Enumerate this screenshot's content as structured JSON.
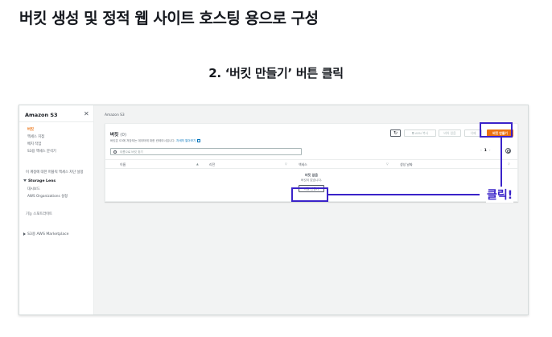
{
  "doc": {
    "title": "버킷 생성 및 정적 웹 사이트 호스팅 용으로 구성",
    "step": "2. ‘버킷 만들기’ 버튼 클릭",
    "annotation": "클릭!"
  },
  "colors": {
    "annotation": "#3a23c9",
    "accent": "#ec7211",
    "link": "#0073bb"
  },
  "sidebar": {
    "title": "Amazon S3",
    "close_icon": "close-icon",
    "items": [
      "버킷",
      "액세스 지점",
      "배치 작업",
      "S3용 액세스 분석기"
    ],
    "block_settings": "이 계정에 대한 퍼블릭 액세스 차단 설정",
    "storage_lens": "Storage Lens",
    "storage_lens_items": [
      "대시보드",
      "AWS Organizations 설정"
    ],
    "feature_spotlight": "기능 스포트라이트",
    "marketplace": "S3용 AWS Marketplace"
  },
  "breadcrumb": "Amazon S3",
  "panel": {
    "title": "버킷",
    "count": "(0)",
    "description": "버킷은 S3에 저장되는 데이터에 대한 컨테이너입니다.",
    "learn_more": "자세히 알아보기",
    "buttons": {
      "refresh": "↻",
      "copy_arn": "⧉ ARN 복사",
      "empty": "비어 있음",
      "delete": "삭제",
      "create": "버킷 만들기"
    },
    "search_placeholder": "이름으로 버킷 찾기",
    "pager": {
      "prev": "‹",
      "page": "1",
      "next": "›"
    },
    "columns": [
      "이름",
      "리전",
      "액세스",
      "생성 날짜"
    ],
    "empty_title": "버킷 없음",
    "empty_desc": "버킷이 없습니다.",
    "create_empty": "버킷 만들기"
  }
}
